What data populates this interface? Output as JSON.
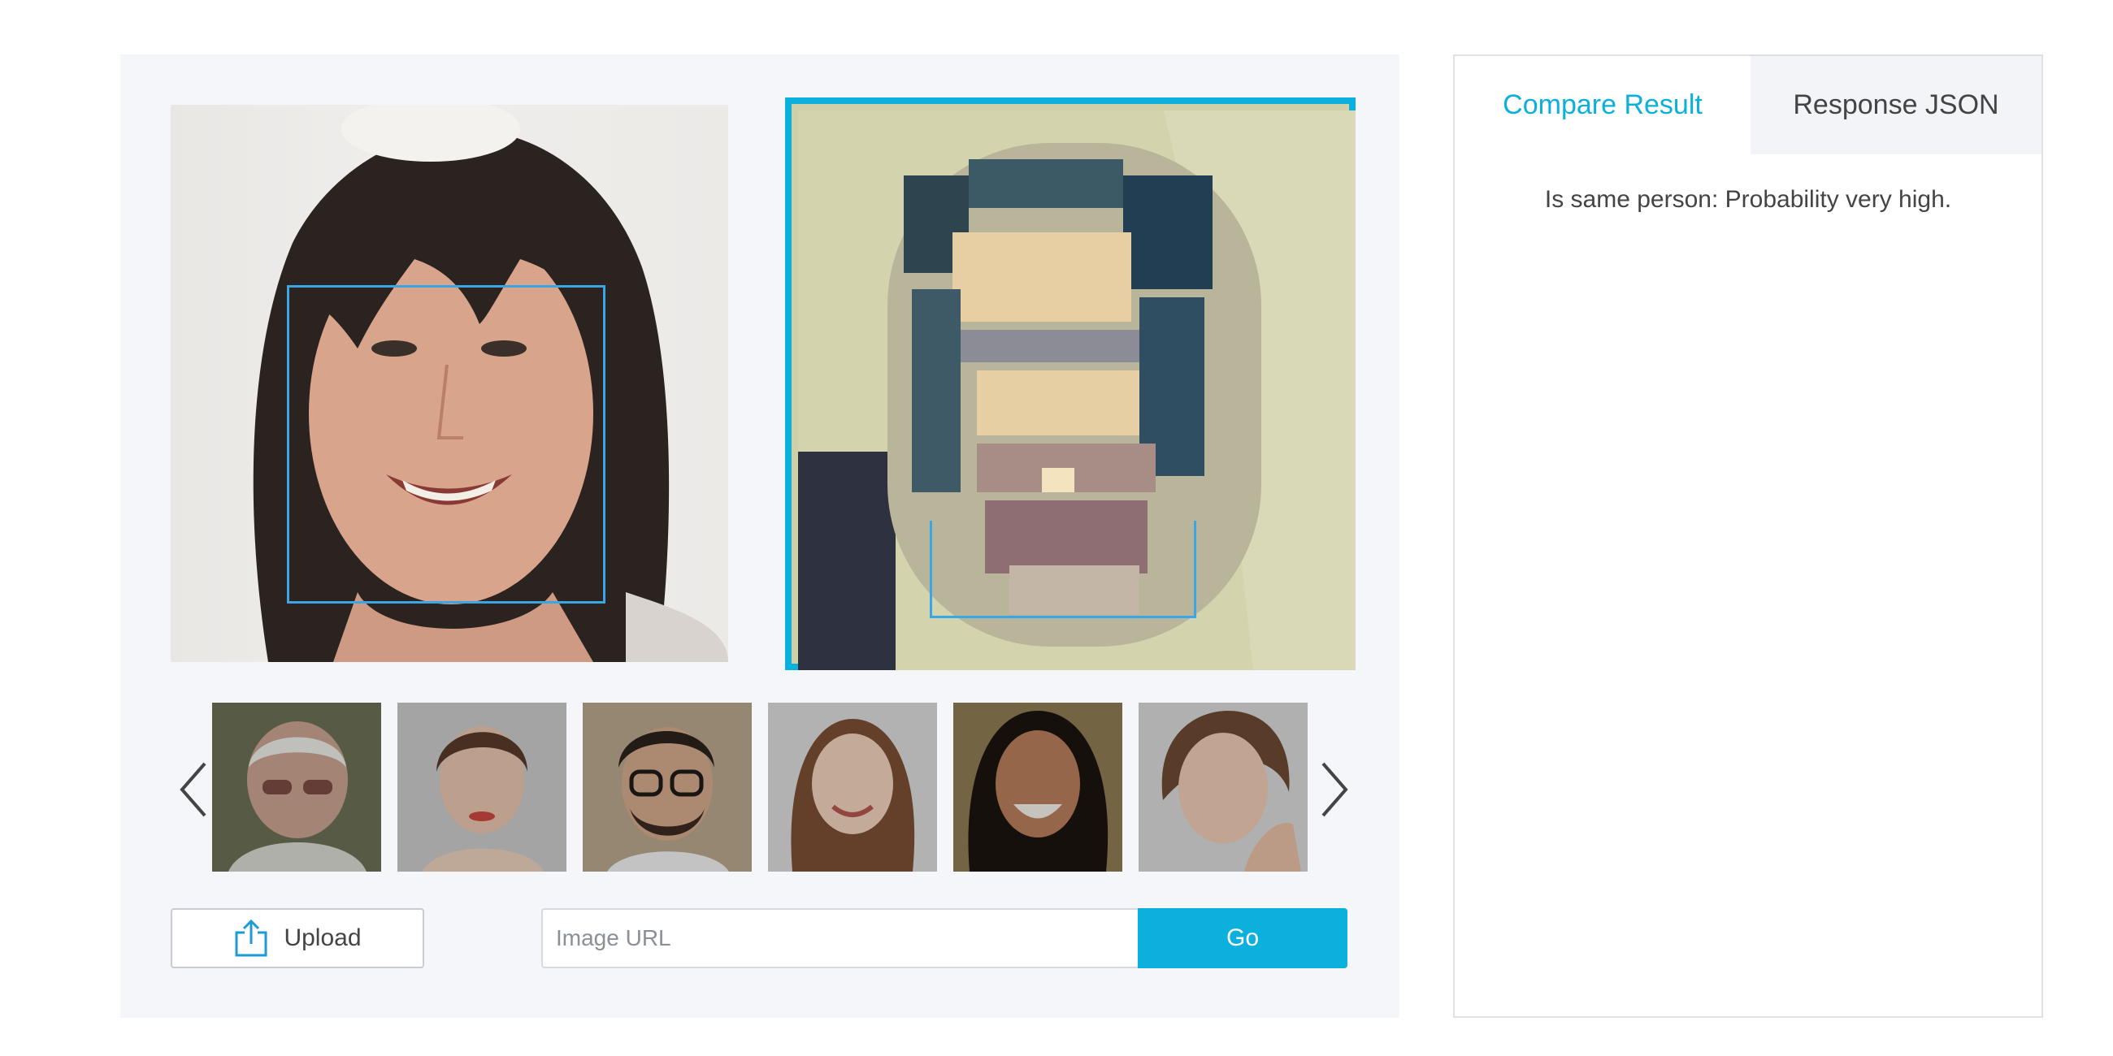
{
  "colors": {
    "accent": "#0bb0dc",
    "face_box": "#3aa6e5",
    "panel_bg": "#f5f6fa"
  },
  "images": {
    "left_face": {
      "description": "face-photo-woman-dark-hair"
    },
    "right_face": {
      "description": "face-photo-pixelated"
    }
  },
  "thumbnails": [
    {
      "name": "thumb-elderly-man"
    },
    {
      "name": "thumb-woman-updo"
    },
    {
      "name": "thumb-man-glasses"
    },
    {
      "name": "thumb-woman-smiling"
    },
    {
      "name": "thumb-woman-curly-hair"
    },
    {
      "name": "thumb-woman-hand-cheek"
    }
  ],
  "controls": {
    "upload_label": "Upload",
    "url_placeholder": "Image URL",
    "url_value": "",
    "go_label": "Go"
  },
  "result": {
    "tabs": [
      {
        "label": "Compare Result",
        "active": true
      },
      {
        "label": "Response JSON",
        "active": false
      }
    ],
    "text": "Is same person: Probability very high."
  },
  "icons": {
    "upload": "upload-icon",
    "prev": "chevron-left-icon",
    "next": "chevron-right-icon"
  }
}
